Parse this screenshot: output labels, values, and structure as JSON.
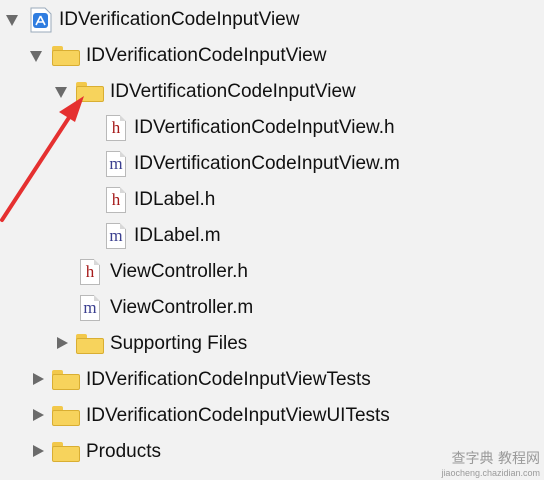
{
  "tree": {
    "project": "IDVerificationCodeInputView",
    "group_main": "IDVerificationCodeInputView",
    "group_sub": "IDVertificationCodeInputView",
    "file_h1": "IDVertificationCodeInputView.h",
    "file_m1": "IDVertificationCodeInputView.m",
    "file_h2": "IDLabel.h",
    "file_m2": "IDLabel.m",
    "file_h3": "ViewController.h",
    "file_m3": "ViewController.m",
    "supporting": "Supporting Files",
    "tests": "IDVerificationCodeInputViewTests",
    "uitests": "IDVerificationCodeInputViewUITests",
    "products": "Products"
  },
  "file_badges": {
    "header": "h",
    "impl": "m"
  },
  "colors": {
    "header_letter": "#a61b1b",
    "impl_letter": "#3b3f8f",
    "arrow": "#e53030",
    "folder": "#f7d35c"
  },
  "watermark": {
    "cn": "查字典 教程网",
    "url": "jiaocheng.chazidian.com"
  }
}
